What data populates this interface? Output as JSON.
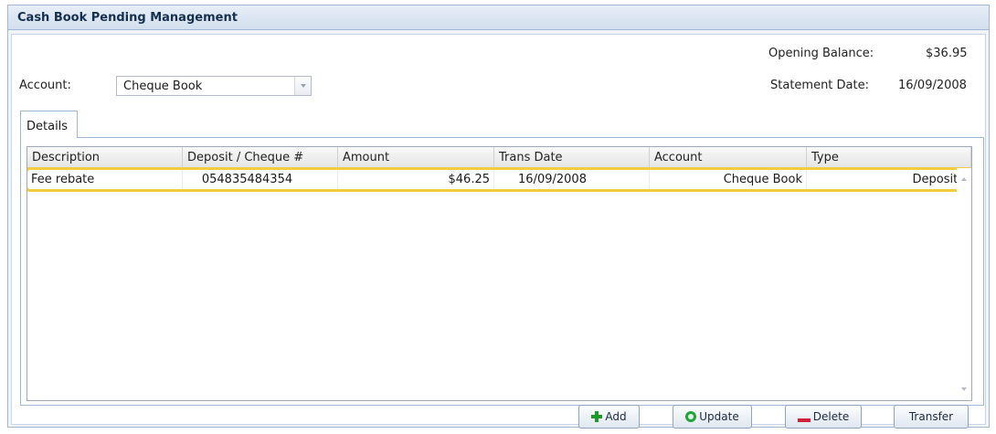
{
  "window": {
    "title": "Cash Book Pending Management"
  },
  "form": {
    "opening_balance_label": "Opening Balance:",
    "opening_balance_value": "$36.95",
    "account_label": "Account:",
    "account_value": "Cheque Book",
    "statement_date_label": "Statement Date:",
    "statement_date_value": "16/09/2008"
  },
  "tabs": [
    {
      "label": "Details",
      "active": true
    }
  ],
  "grid": {
    "columns": [
      "Description",
      "Deposit / Cheque #",
      "Amount",
      "Trans Date",
      "Account",
      "Type"
    ],
    "rows": [
      {
        "description": "Fee rebate",
        "deposit_cheque": "054835484354",
        "amount": "$46.25",
        "trans_date": "16/09/2008",
        "account": "Cheque Book",
        "type": "Deposits"
      }
    ]
  },
  "buttons": {
    "add": "Add",
    "update": "Update",
    "delete": "Delete",
    "transfer": "Transfer"
  },
  "icons": {
    "add": "plus-icon",
    "update": "refresh-icon",
    "delete": "minus-icon",
    "dropdown": "chevron-down-icon"
  },
  "colors": {
    "highlight": "#f2cd3f",
    "title_bg": "#d3dfee",
    "add_icon": "#1f9a2a",
    "update_icon": "#26a23a",
    "delete_icon": "#d3203a"
  }
}
